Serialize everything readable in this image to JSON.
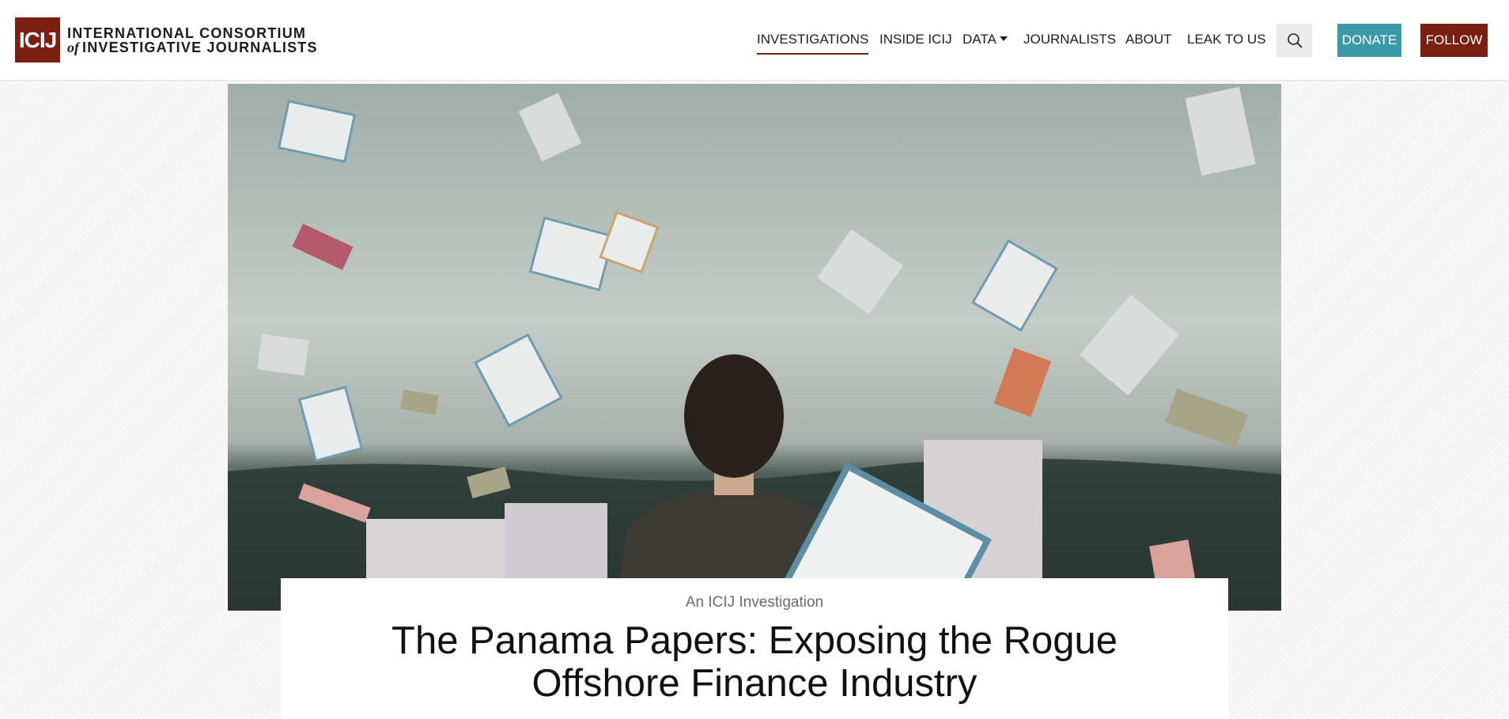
{
  "logo": {
    "mark": "ICIJ",
    "line1": "INTERNATIONAL CONSORTIUM",
    "line2_of": "of",
    "line2": "INVESTIGATIVE JOURNALISTS"
  },
  "nav": {
    "items": [
      {
        "label": "INVESTIGATIONS",
        "active": true
      },
      {
        "label": "INSIDE ICIJ"
      },
      {
        "label": "DATA",
        "dropdown": true
      },
      {
        "label": "JOURNALISTS"
      },
      {
        "label": "ABOUT"
      },
      {
        "label": "LEAK TO US"
      }
    ],
    "search_icon": "search-icon",
    "donate_label": "DONATE",
    "follow_label": "FOLLOW"
  },
  "hero": {
    "image": "man-in-suit-facing-stormy-sea-with-flying-documents-and-cash"
  },
  "article": {
    "kicker": "An ICIJ Investigation",
    "title": "The Panama Papers: Exposing the Rogue Offshore Finance Industry"
  },
  "colors": {
    "brand_red": "#7a1f12",
    "donate_teal": "#3a9aa8",
    "search_bg": "#ebebeb"
  }
}
